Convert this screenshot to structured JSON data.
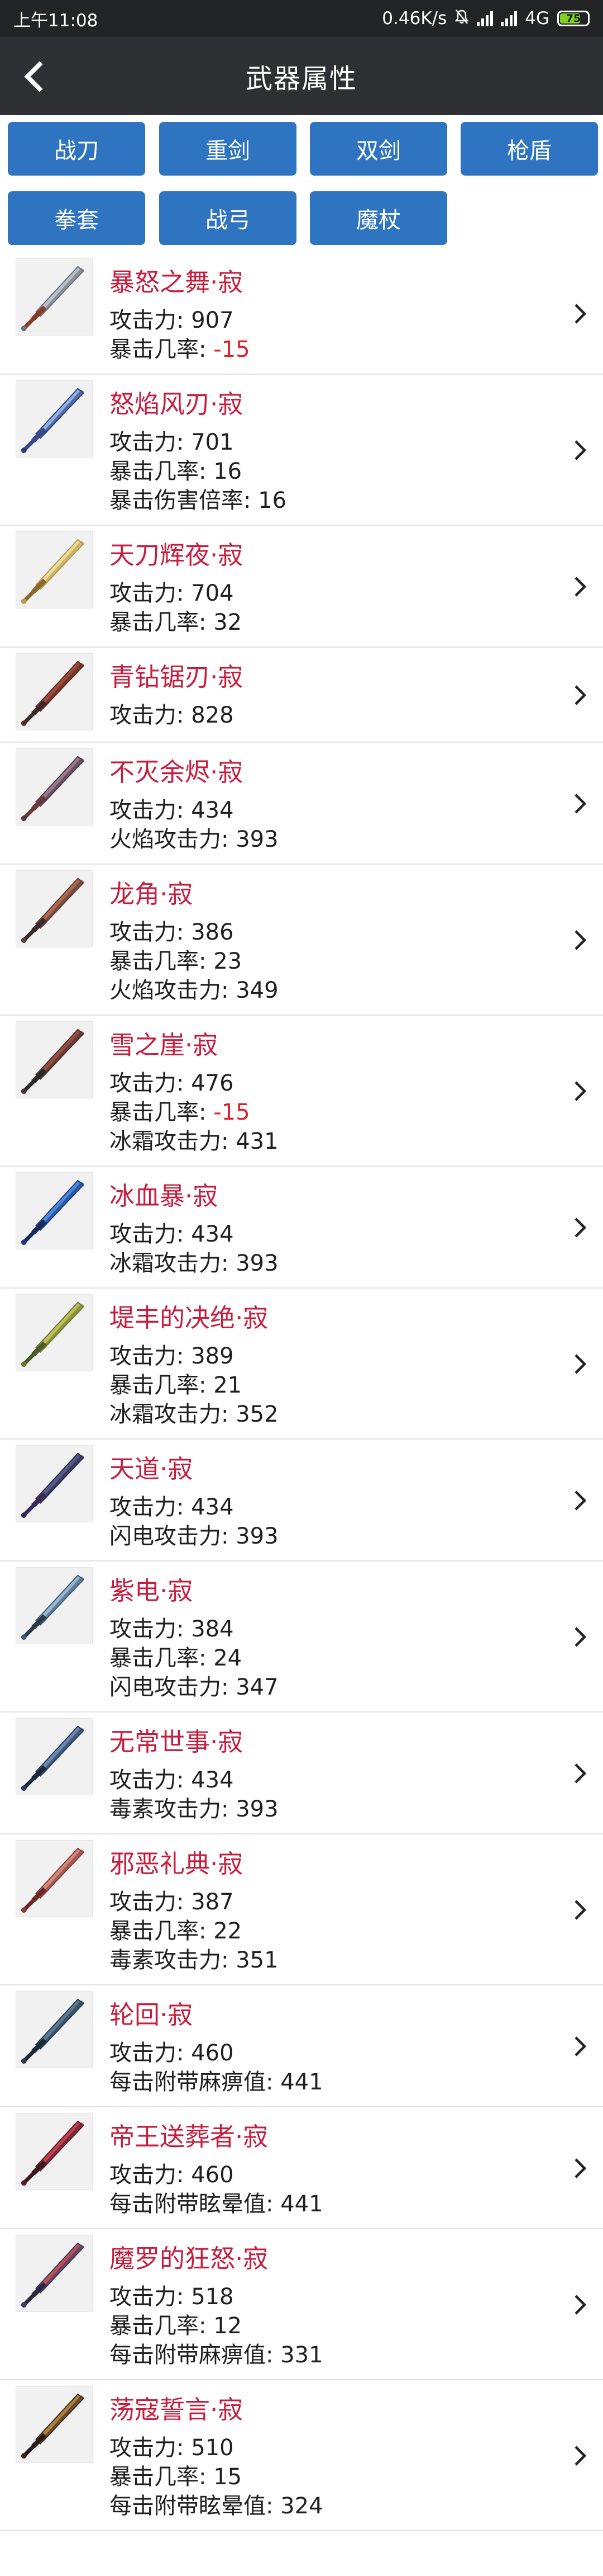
{
  "status_bar": {
    "time": "上午11:08",
    "net_speed": "0.46K/s",
    "network": "4G",
    "battery": "75"
  },
  "header": {
    "title": "武器属性"
  },
  "categories": [
    "战刀",
    "重剑",
    "双剑",
    "枪盾",
    "拳套",
    "战弓",
    "魔杖"
  ],
  "weapons": [
    {
      "name": "暴怒之舞·寂",
      "icon": "weapon-thumbnail-blade",
      "stats": [
        {
          "label": "攻击力: ",
          "value": "907",
          "negative": false
        },
        {
          "label": "暴击几率: ",
          "value": "-15",
          "negative": true
        }
      ]
    },
    {
      "name": "怒焰风刃·寂",
      "icon": "weapon-thumbnail-blade",
      "stats": [
        {
          "label": "攻击力: ",
          "value": "701",
          "negative": false
        },
        {
          "label": "暴击几率: ",
          "value": "16",
          "negative": false
        },
        {
          "label": "暴击伤害倍率: ",
          "value": "16",
          "negative": false
        }
      ]
    },
    {
      "name": "天刀辉夜·寂",
      "icon": "weapon-thumbnail-blade",
      "stats": [
        {
          "label": "攻击力: ",
          "value": "704",
          "negative": false
        },
        {
          "label": "暴击几率: ",
          "value": "32",
          "negative": false
        }
      ]
    },
    {
      "name": "青钻锯刃·寂",
      "icon": "weapon-thumbnail-blade",
      "stats": [
        {
          "label": "攻击力: ",
          "value": "828",
          "negative": false
        }
      ]
    },
    {
      "name": "不灭余烬·寂",
      "icon": "weapon-thumbnail-blade",
      "stats": [
        {
          "label": "攻击力: ",
          "value": "434",
          "negative": false
        },
        {
          "label": "火焰攻击力: ",
          "value": "393",
          "negative": false
        }
      ]
    },
    {
      "name": "龙角·寂",
      "icon": "weapon-thumbnail-blade",
      "stats": [
        {
          "label": "攻击力: ",
          "value": "386",
          "negative": false
        },
        {
          "label": "暴击几率: ",
          "value": "23",
          "negative": false
        },
        {
          "label": "火焰攻击力: ",
          "value": "349",
          "negative": false
        }
      ]
    },
    {
      "name": "雪之崖·寂",
      "icon": "weapon-thumbnail-blade",
      "stats": [
        {
          "label": "攻击力: ",
          "value": "476",
          "negative": false
        },
        {
          "label": "暴击几率: ",
          "value": "-15",
          "negative": true
        },
        {
          "label": "冰霜攻击力: ",
          "value": "431",
          "negative": false
        }
      ]
    },
    {
      "name": "冰血暴·寂",
      "icon": "weapon-thumbnail-blade",
      "stats": [
        {
          "label": "攻击力: ",
          "value": "434",
          "negative": false
        },
        {
          "label": "冰霜攻击力: ",
          "value": "393",
          "negative": false
        }
      ]
    },
    {
      "name": "堤丰的决绝·寂",
      "icon": "weapon-thumbnail-blade",
      "stats": [
        {
          "label": "攻击力: ",
          "value": "389",
          "negative": false
        },
        {
          "label": "暴击几率: ",
          "value": "21",
          "negative": false
        },
        {
          "label": "冰霜攻击力: ",
          "value": "352",
          "negative": false
        }
      ]
    },
    {
      "name": "天道·寂",
      "icon": "weapon-thumbnail-blade",
      "stats": [
        {
          "label": "攻击力: ",
          "value": "434",
          "negative": false
        },
        {
          "label": "闪电攻击力: ",
          "value": "393",
          "negative": false
        }
      ]
    },
    {
      "name": "紫电·寂",
      "icon": "weapon-thumbnail-blade",
      "stats": [
        {
          "label": "攻击力: ",
          "value": "384",
          "negative": false
        },
        {
          "label": "暴击几率: ",
          "value": "24",
          "negative": false
        },
        {
          "label": "闪电攻击力: ",
          "value": "347",
          "negative": false
        }
      ]
    },
    {
      "name": "无常世事·寂",
      "icon": "weapon-thumbnail-blade",
      "stats": [
        {
          "label": "攻击力: ",
          "value": "434",
          "negative": false
        },
        {
          "label": "毒素攻击力: ",
          "value": "393",
          "negative": false
        }
      ]
    },
    {
      "name": "邪恶礼典·寂",
      "icon": "weapon-thumbnail-blade",
      "stats": [
        {
          "label": "攻击力: ",
          "value": "387",
          "negative": false
        },
        {
          "label": "暴击几率: ",
          "value": "22",
          "negative": false
        },
        {
          "label": "毒素攻击力: ",
          "value": "351",
          "negative": false
        }
      ]
    },
    {
      "name": "轮回·寂",
      "icon": "weapon-thumbnail-blade",
      "stats": [
        {
          "label": "攻击力: ",
          "value": "460",
          "negative": false
        },
        {
          "label": "每击附带麻痹值: ",
          "value": "441",
          "negative": false
        }
      ]
    },
    {
      "name": "帝王送葬者·寂",
      "icon": "weapon-thumbnail-blade",
      "stats": [
        {
          "label": "攻击力: ",
          "value": "460",
          "negative": false
        },
        {
          "label": "每击附带眩晕值: ",
          "value": "441",
          "negative": false
        }
      ]
    },
    {
      "name": "魔罗的狂怒·寂",
      "icon": "weapon-thumbnail-blade",
      "stats": [
        {
          "label": "攻击力: ",
          "value": "518",
          "negative": false
        },
        {
          "label": "暴击几率: ",
          "value": "12",
          "negative": false
        },
        {
          "label": "每击附带麻痹值: ",
          "value": "331",
          "negative": false
        }
      ]
    },
    {
      "name": "荡寇誓言·寂",
      "icon": "weapon-thumbnail-blade",
      "stats": [
        {
          "label": "攻击力: ",
          "value": "510",
          "negative": false
        },
        {
          "label": "暴击几率: ",
          "value": "15",
          "negative": false
        },
        {
          "label": "每击附带眩晕值: ",
          "value": "324",
          "negative": false
        }
      ]
    }
  ],
  "colors": {
    "title_bar": "#2f3033",
    "status_bar": "#222426",
    "button_blue": "#2f74c0",
    "weapon_name": "#c61e3e",
    "negative_value": "#e0202b",
    "divider": "#e3e3e3"
  },
  "icons": {
    "back": "back-arrow-icon",
    "row_chevron": "chevron-right-icon",
    "mute": "mute-bell-icon",
    "signal": "signal-icon",
    "battery": "battery-icon"
  }
}
